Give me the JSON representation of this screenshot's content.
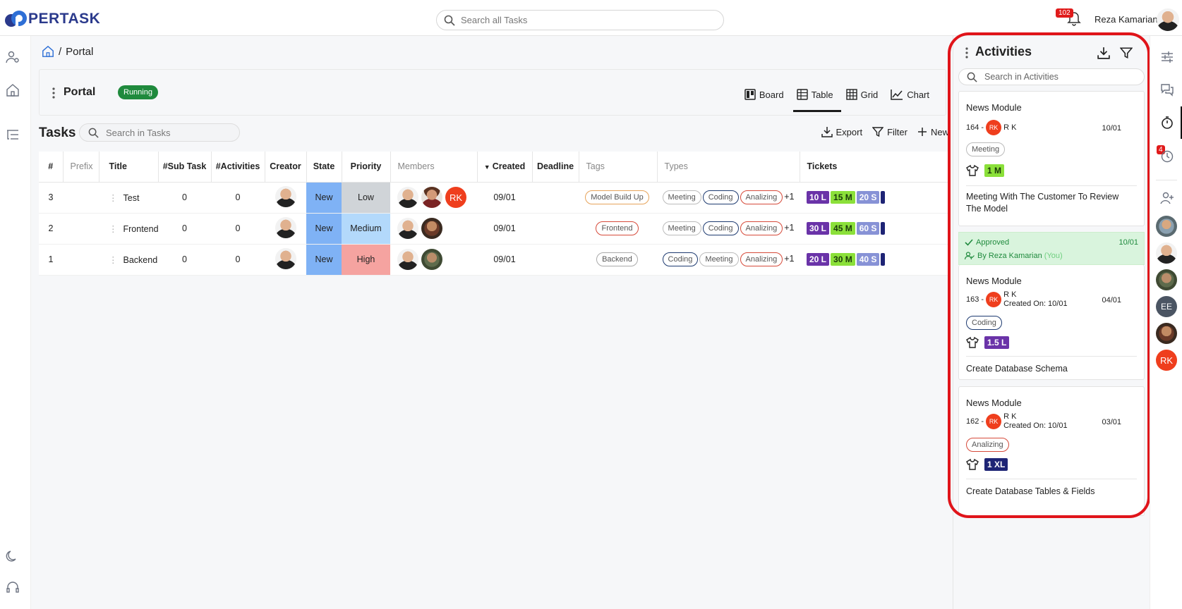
{
  "app": {
    "brand": "PERTASK"
  },
  "header": {
    "search_placeholder": "Search all Tasks",
    "notification_count": "102",
    "user_name": "Reza Kamarian"
  },
  "breadcrumb": {
    "separator": "/",
    "current": "Portal"
  },
  "project": {
    "title": "Portal",
    "status": "Running",
    "views": [
      {
        "label": "Board",
        "icon": "board-icon"
      },
      {
        "label": "Table",
        "icon": "table-icon",
        "active": true
      },
      {
        "label": "Grid",
        "icon": "grid-icon"
      },
      {
        "label": "Chart",
        "icon": "chart-icon"
      }
    ]
  },
  "tasks": {
    "title": "Tasks",
    "search_placeholder": "Search in Tasks",
    "actions": {
      "export": "Export",
      "filter": "Filter",
      "new": "New"
    },
    "columns": [
      "#",
      "Prefix",
      "Title",
      "#Sub Task",
      "#Activities",
      "Creator",
      "State",
      "Priority",
      "Members",
      "Created",
      "Deadline",
      "Tags",
      "Types",
      "Tickets"
    ],
    "rows": [
      {
        "num": "3",
        "prefix": "",
        "title": "Test",
        "subtasks": "0",
        "activities": "0",
        "state": "New",
        "priority": "Low",
        "created": "09/01",
        "deadline": "",
        "tag": "Model Build Up",
        "types": [
          "Meeting",
          "Coding",
          "Analizing"
        ],
        "types_more": "+1",
        "tickets": [
          "10 L",
          "15 M",
          "20 S"
        ]
      },
      {
        "num": "2",
        "prefix": "",
        "title": "Frontend",
        "subtasks": "0",
        "activities": "0",
        "state": "New",
        "priority": "Medium",
        "created": "09/01",
        "deadline": "",
        "tag": "Frontend",
        "types": [
          "Meeting",
          "Coding",
          "Analizing"
        ],
        "types_more": "+1",
        "tickets": [
          "30 L",
          "45 M",
          "60 S"
        ]
      },
      {
        "num": "1",
        "prefix": "",
        "title": "Backend",
        "subtasks": "0",
        "activities": "0",
        "state": "New",
        "priority": "High",
        "created": "09/01",
        "deadline": "",
        "tag": "Backend",
        "types": [
          "Coding",
          "Meeting",
          "Analizing"
        ],
        "types_more": "+1",
        "tickets": [
          "20 L",
          "30 M",
          "40 S"
        ]
      }
    ]
  },
  "activities": {
    "title": "Activities",
    "search_placeholder": "Search in Activities",
    "items": [
      {
        "module": "News Module",
        "id": "164 -",
        "user_initials": "RK",
        "user": "R K",
        "created_on": "",
        "date": "10/01",
        "type": "Meeting",
        "ticket": "1 M",
        "desc": "Meeting With The Customer To Review The Model"
      },
      {
        "approved_label": "Approved",
        "approved_date": "10/01",
        "approved_by": "By Reza Kamarian",
        "approved_you": "(You)",
        "module": "News Module",
        "id": "163 -",
        "user_initials": "RK",
        "user": "R K",
        "created_on": "Created On: 10/01",
        "date": "04/01",
        "type": "Coding",
        "ticket": "1.5 L",
        "desc": "Create Database Schema"
      },
      {
        "module": "News Module",
        "id": "162 -",
        "user_initials": "RK",
        "user": "R K",
        "created_on": "Created On: 10/01",
        "date": "03/01",
        "type": "Analizing",
        "ticket": "1 XL",
        "desc": "Create Database Tables & Fields"
      }
    ]
  },
  "right_rail": {
    "timer_badge": "4",
    "members": [
      "EE",
      "RK"
    ]
  },
  "member_rk": "RK",
  "colors": {
    "accent": "#1f8a3d",
    "highlight": "#e0141a",
    "state_new": "#7fb2f5",
    "priority_low": "#d0d4d8",
    "priority_medium": "#b3d9fb",
    "priority_high": "#f5a3a0"
  }
}
